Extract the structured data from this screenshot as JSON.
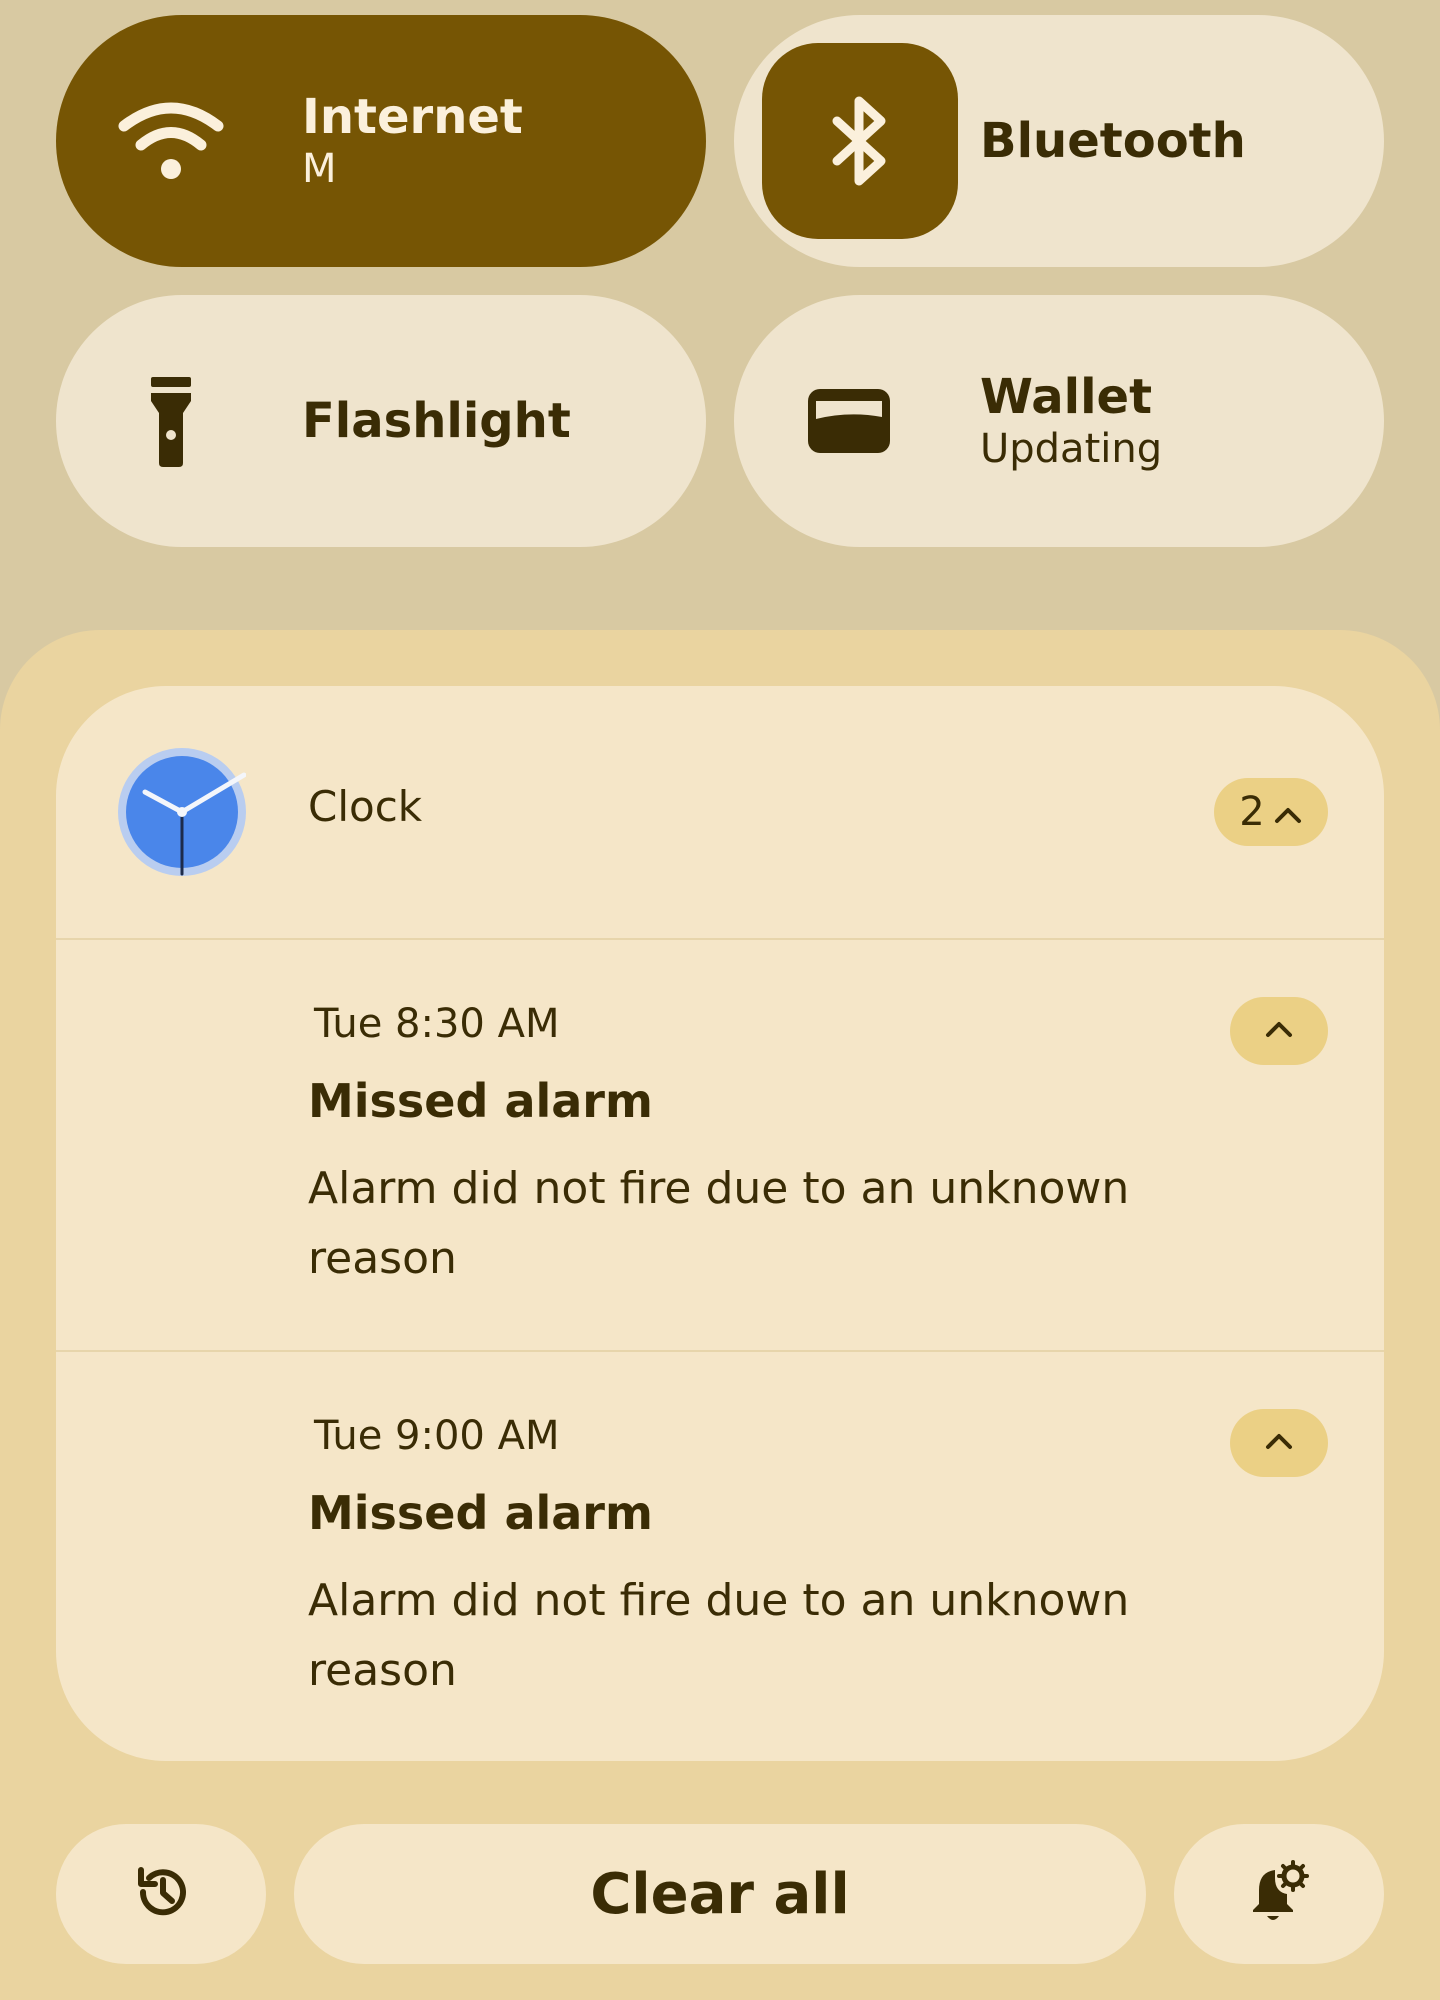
{
  "tiles": {
    "internet": {
      "label": "Internet",
      "sub": "M",
      "icon": "wifi-icon"
    },
    "bluetooth": {
      "label": "Bluetooth",
      "icon": "bluetooth-icon"
    },
    "flashlight": {
      "label": "Flashlight",
      "icon": "flashlight-icon"
    },
    "wallet": {
      "label": "Wallet",
      "sub": "Updating",
      "icon": "wallet-icon"
    }
  },
  "notification_group": {
    "app_name": "Clock",
    "app_icon": "clock-icon",
    "count": "2",
    "items": [
      {
        "time": "Tue 8:30 AM",
        "title": "Missed alarm",
        "body": "Alarm did not fire due to an unknown reason"
      },
      {
        "time": "Tue 9:00 AM",
        "title": "Missed alarm",
        "body": "Alarm did not fire due to an unknown reason"
      }
    ]
  },
  "footer": {
    "clear_all_label": "Clear all",
    "history_icon": "history-icon",
    "settings_icon": "notification-settings-icon"
  },
  "colors": {
    "accent_dark": "#765504",
    "tile_light": "#efe4cd",
    "shade": "#ead4a0",
    "card": "#f5e6c8",
    "pill": "#ebd085",
    "text": "#3a2c05"
  }
}
